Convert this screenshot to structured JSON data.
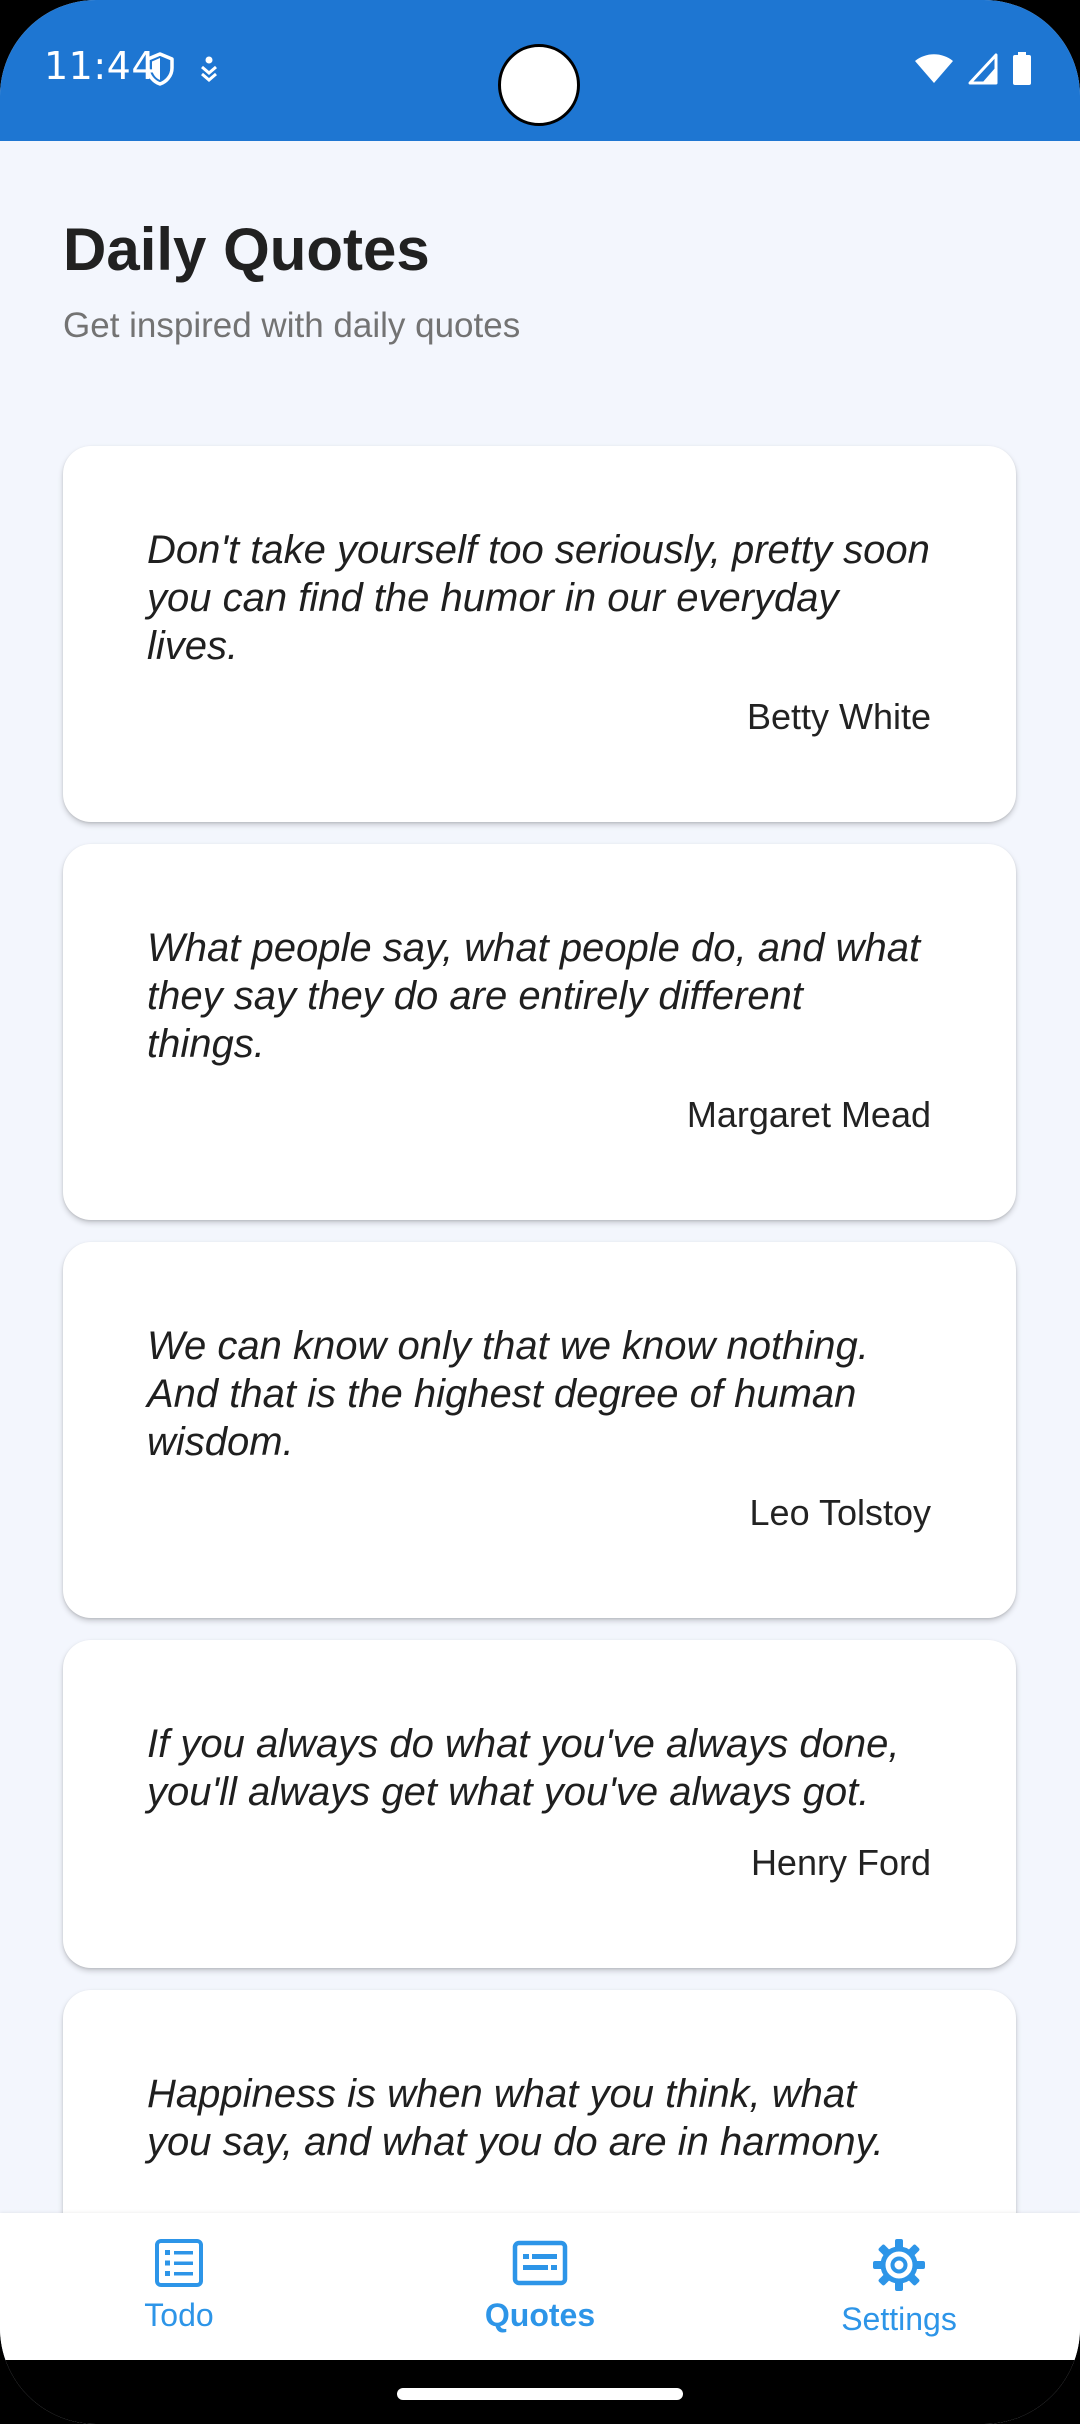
{
  "status_bar": {
    "time": "11:44",
    "icons_left": [
      "shield-icon",
      "accessibility-icon"
    ],
    "icons_right": [
      "wifi-icon",
      "cell-signal-icon",
      "battery-icon"
    ]
  },
  "header": {
    "title": "Daily Quotes",
    "subtitle": "Get inspired with daily quotes"
  },
  "quotes": [
    {
      "text": "Don't take yourself too seriously, pretty soon you can find the humor in our everyday lives.",
      "author": "Betty White"
    },
    {
      "text": "What people say, what people do, and what they say they do are entirely different things.",
      "author": "Margaret Mead"
    },
    {
      "text": "We can know only that we know nothing. And that is the highest degree of human wisdom.",
      "author": "Leo Tolstoy"
    },
    {
      "text": "If you always do what you've always done, you'll always get what you've always got.",
      "author": "Henry Ford"
    },
    {
      "text": "Happiness is when what you think, what you say, and what you do are in harmony.",
      "author": ""
    }
  ],
  "bottom_nav": {
    "items": [
      {
        "label": "Todo",
        "icon": "list-icon",
        "active": false
      },
      {
        "label": "Quotes",
        "icon": "quote-card-icon",
        "active": true
      },
      {
        "label": "Settings",
        "icon": "gear-icon",
        "active": false
      }
    ]
  },
  "colors": {
    "accent": "#1E76D2",
    "nav_accent": "#2D95E8",
    "background": "#F3F6FD"
  }
}
